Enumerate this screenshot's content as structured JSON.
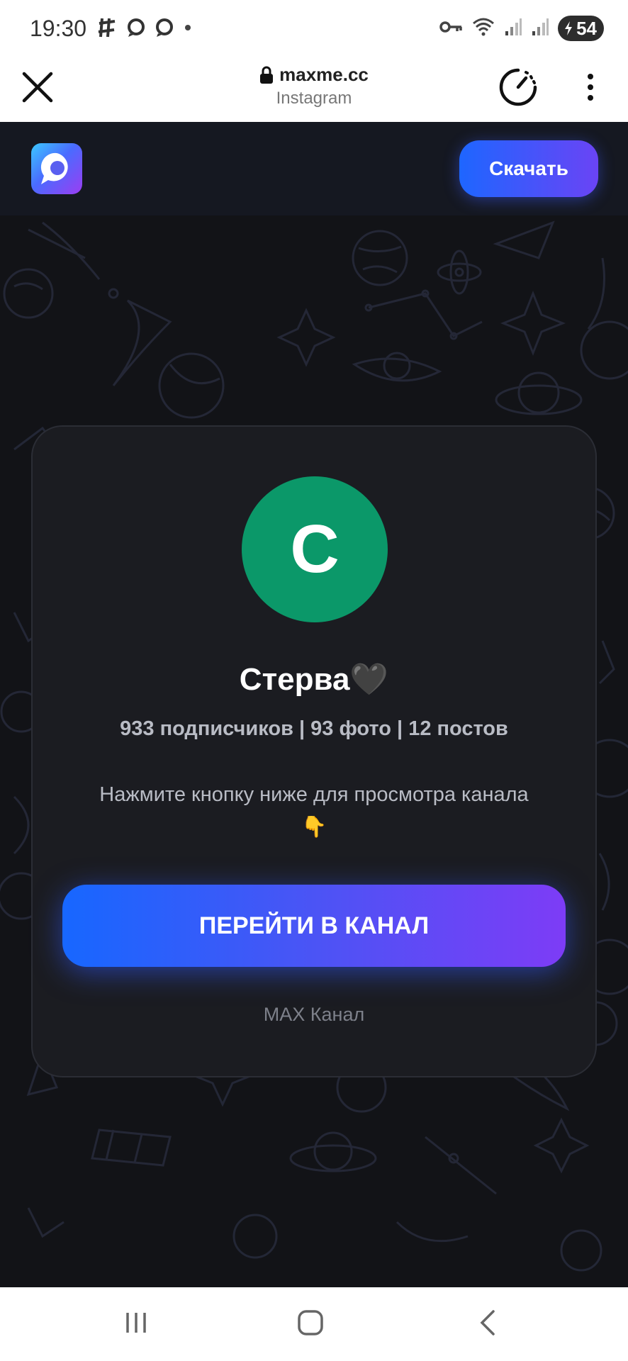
{
  "status_bar": {
    "time": "19:30",
    "left_icons": [
      "hashtag-app-icon",
      "chat-bubble-icon",
      "chat-bubble-icon",
      "dot-icon"
    ],
    "right_icons": [
      "vpn-key-icon",
      "wifi-icon",
      "signal-icon",
      "signal-icon"
    ],
    "battery": "54"
  },
  "browser": {
    "url": "maxme.cc",
    "subtitle": "Instagram"
  },
  "header": {
    "download_label": "Скачать"
  },
  "card": {
    "avatar_letter": "С",
    "channel_name": "Стерва🖤",
    "stats": "933 подписчиков | 93 фото | 12 постов",
    "hint_text": "Нажмите кнопку ниже для просмотра канала",
    "hint_emoji": "👇",
    "go_button_label": "ПЕРЕЙТИ В КАНАЛ",
    "footer": "MAX Канал"
  },
  "colors": {
    "avatar_bg": "#0b9869",
    "button_gradient_start": "#1767ff",
    "button_gradient_end": "#7d3cf6",
    "page_bg": "#121317"
  }
}
